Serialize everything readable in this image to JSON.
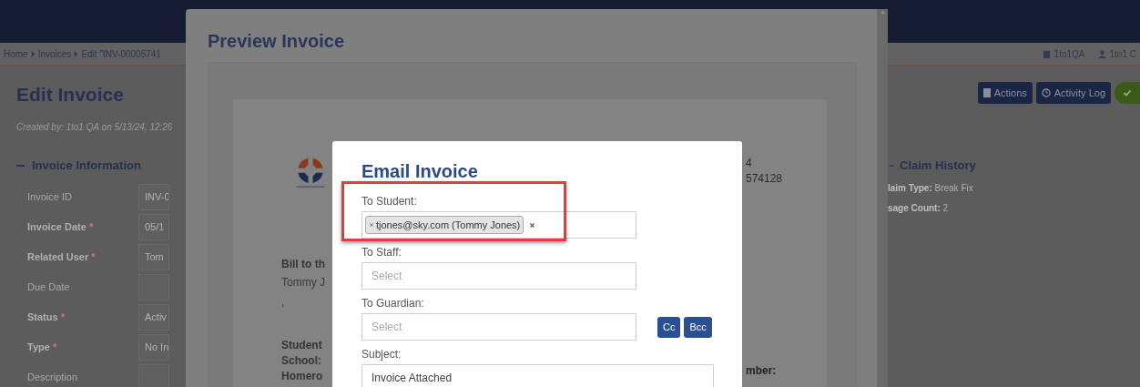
{
  "breadcrumb": [
    "Home",
    "Invoices",
    "Edit \"INV-00005741"
  ],
  "user_menu": [
    {
      "label": "1to1QA"
    },
    {
      "label": "1to1 C"
    }
  ],
  "page": {
    "title": "Edit Invoice",
    "created_by": "Created by: 1to1 QA on 5/13/24, 12:26",
    "section": "Invoice Information",
    "fields": [
      {
        "label": "Invoice ID",
        "value": "INV-0"
      },
      {
        "label": "Invoice Date",
        "required_mark": "*",
        "value": "05/1"
      },
      {
        "label": "Related User",
        "required_mark": "*",
        "value": "Tom"
      },
      {
        "label": "Due Date"
      },
      {
        "label": "Status",
        "required_mark": "*",
        "value": "Activ"
      },
      {
        "label": "Type",
        "required_mark": "*",
        "value": "No In"
      },
      {
        "label": "Description"
      }
    ],
    "buttons": [
      "Actions",
      "Activity Log"
    ],
    "claim_history": {
      "title": "Claim History",
      "rows": [
        {
          "label": "laim Type:",
          "value": "Break Fix"
        },
        {
          "label": "sage Count:",
          "value": "2"
        }
      ]
    }
  },
  "preview": {
    "title": "Preview Invoice",
    "bill_to": "Bill to th",
    "bill_name": "Tommy J",
    "bill_line": ",",
    "student_labels": [
      "Student",
      "School:",
      "Homero"
    ],
    "right_lines": [
      "4",
      "574128"
    ],
    "right_label": "mber:"
  },
  "email": {
    "title": "Email Invoice",
    "cc_buttons": [
      "Cc",
      "Bcc"
    ],
    "fields": [
      {
        "kind": "tags",
        "label": "To Student:",
        "tags": [
          "tjones@sky.com (Tommy Jones)"
        ],
        "highlighted": true
      },
      {
        "kind": "select",
        "label": "To Staff:",
        "placeholder": "Select",
        "highlighted": false
      },
      {
        "kind": "select",
        "label": "To Guardian:",
        "placeholder": "Select",
        "highlighted": false
      },
      {
        "kind": "text",
        "label": "Subject:",
        "value": "Invoice Attached",
        "highlighted": false
      }
    ]
  }
}
